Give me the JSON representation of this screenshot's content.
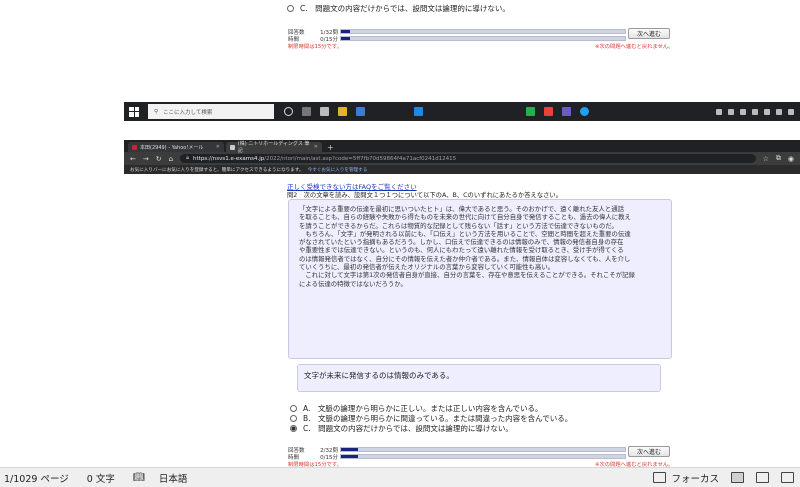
{
  "top_section": {
    "option_c": "C.　問題文の内容だけからでは、設問文は論理的に導けない。",
    "answered_label": "回答数",
    "answered_value": "1/32問",
    "answered_fraction": 0.03,
    "time_label": "時間",
    "time_value": "0/15分",
    "time_fraction": 0.03,
    "time_limit_note": "制限時間は15分です。",
    "next_button": "次へ進む",
    "next_warning": "※次の問題へ進むと戻れません。"
  },
  "taskbar": {
    "search_placeholder": "ここに入力して検索"
  },
  "browser": {
    "tabs": [
      {
        "title": "本田(2949) - Yahoo!メール"
      },
      {
        "title": "(株) ニトリホールディングス 筆記"
      }
    ],
    "url_domain": "https://nsvs1.e-exams4.jp",
    "url_path": "/2022/ntori/main/ast.asp?code=5ff7fb70d59864f4a71acf0241d12415",
    "favorites_hint": "お気に入りバーにお気に入りを登録すると、簡単にアクセスできるようになります。",
    "favorites_link": "今すぐお気に入りを管理する"
  },
  "exam": {
    "faq_link": "正しく受検できない方はFAQをご覧ください",
    "question": "問2　次の文章を読み、設問文１つ１つについて以下のA、B、Cのいずれにあたるか答えなさい。",
    "passage_lines": [
      "「文字による重要の伝達を最初に思いついたヒト」は、偉大であると思う。そのおかげで、遠く離れた友人と通話",
      "を取ることも、自らの経験や失敗から得たものを未来の世代に向けて自分自身で発信することも、過去の偉人に教え",
      "を請うことができるからだ。これらは物質的な記録として残らない「話す」という方法で伝達できないものだ。",
      "　もちろん、「文字」が発明される以前にも、「口伝え」という方法を用いることで、空間と時間を超えた重要の伝達",
      "がなされていたという指摘もあるだろう。しかし、口伝えで伝達できるのは情報のみで、情報の発信者自身の存在",
      "や重要性までは伝達できない。というのも、何人にもわたって遠い離れた情報を受け取るとき、受け手が得てくる",
      "のは情報発信者ではなく、自分にその情報を伝えた者か仲介者である。また、情報自体は変容しなくても、人を介し",
      "ていくうちに、最初の発信者が伝えたオリジナルの言葉から変容していく可能性も高い。",
      "　これに対して文字は第1次の発信者自身が直接、自分の言葉を、存在や意思を伝えることができる。それこそが記録",
      "による伝達の特徴ではないだろうか。"
    ],
    "statement": "文字が未来に発信するのは情報のみである。",
    "options": [
      {
        "label": "A.　文脈の論理から明らかに正しい。または正しい内容を含んでいる。",
        "selected": false
      },
      {
        "label": "B.　文脈の論理から明らかに間違っている。または間違った内容を含んでいる。",
        "selected": false
      },
      {
        "label": "C.　問題文の内容だけからでは、設問文は論理的に導けない。",
        "selected": true
      }
    ],
    "answered_label": "回答数",
    "answered_value": "2/32問",
    "answered_fraction": 0.06,
    "time_label": "時間",
    "time_value": "0/15分",
    "time_fraction": 0.06,
    "time_limit_note": "制限時間は15分です。",
    "next_button": "次へ進む",
    "next_warning": "※次の問題へ進むと戻れません。"
  },
  "statusbar": {
    "page": "1/1029 ページ",
    "words": "0 文字",
    "language": "日本語",
    "focus": "フォーカス"
  }
}
